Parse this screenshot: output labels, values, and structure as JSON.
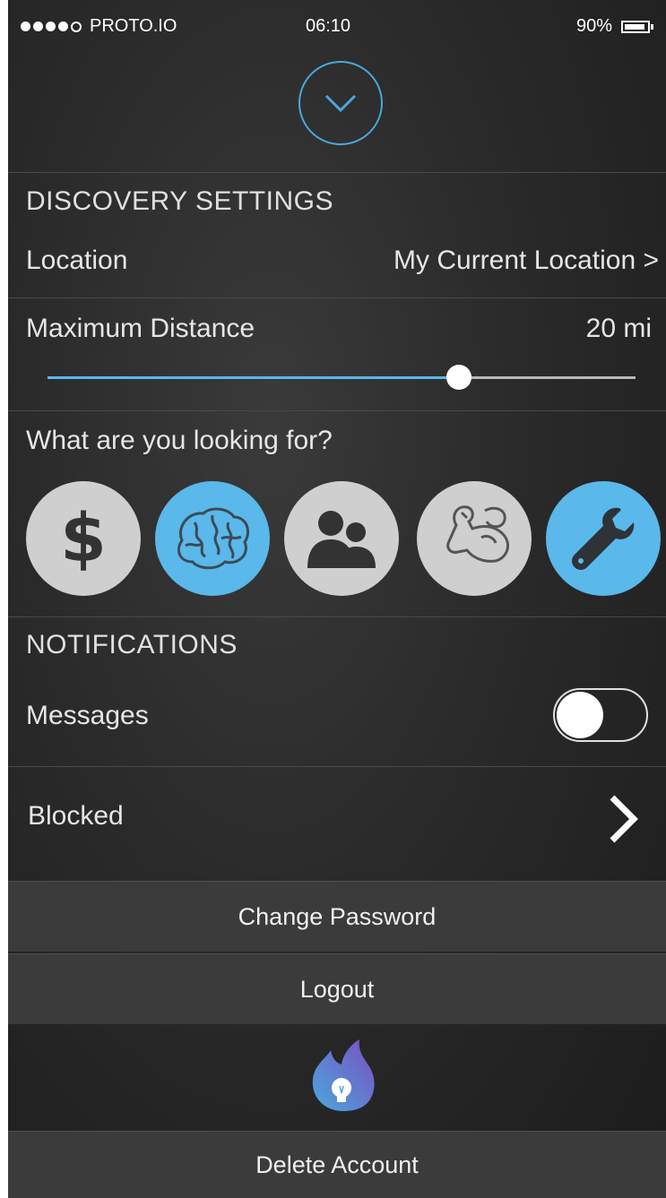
{
  "status_bar": {
    "carrier": "PROTO.IO",
    "time": "06:10",
    "battery": "90%",
    "battery_level": 0.9
  },
  "discovery": {
    "heading": "DISCOVERY SETTINGS",
    "location_label": "Location",
    "location_value": "My Current Location >"
  },
  "distance": {
    "label": "Maximum Distance",
    "value": "20 mi",
    "slider_fraction": 0.7
  },
  "looking_for": {
    "heading": "What are you looking for?",
    "options": [
      {
        "icon": "dollar-icon",
        "selected": false
      },
      {
        "icon": "brain-icon",
        "selected": true
      },
      {
        "icon": "people-icon",
        "selected": false
      },
      {
        "icon": "flexing-arm-icon",
        "selected": false
      },
      {
        "icon": "wrench-icon",
        "selected": true
      }
    ]
  },
  "notifications": {
    "heading": "NOTIFICATIONS",
    "messages_label": "Messages",
    "messages_enabled": false
  },
  "blocked": {
    "label": "Blocked"
  },
  "buttons": {
    "change_password": "Change Password",
    "logout": "Logout",
    "delete_account": "Delete Account"
  },
  "colors": {
    "accent": "#5ab8ea",
    "background": "#2a2a2a",
    "button_bg": "#3b3b3b"
  }
}
